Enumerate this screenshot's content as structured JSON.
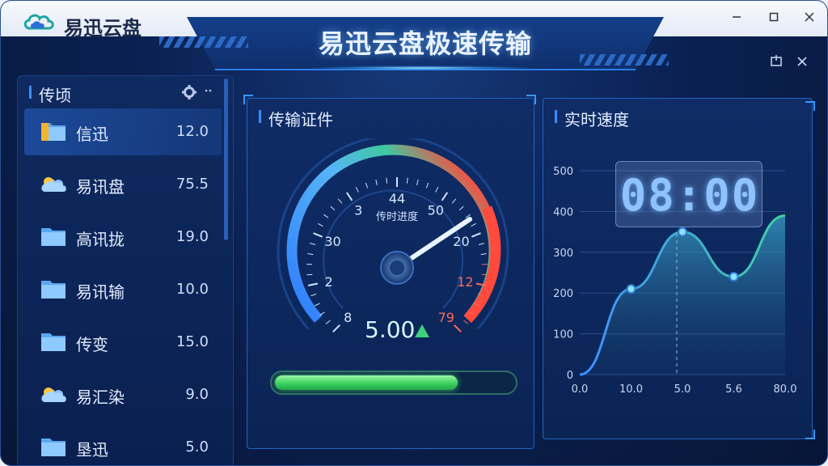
{
  "app": {
    "name": "易迅云盘",
    "title": "易迅云盘极速传输"
  },
  "colors": {
    "accent": "#3a8dff",
    "progress": "#3bd160",
    "gauge_low": "#2e7bff",
    "gauge_high": "#ff4a3d",
    "chart_line": "#3fa9ff"
  },
  "sidebar": {
    "title": "传顷",
    "items": [
      {
        "name": "信迅",
        "value": "12.0",
        "icon": "folder-icon",
        "selected": true
      },
      {
        "name": "易讯盘",
        "value": "75.5",
        "icon": "cloud-icon"
      },
      {
        "name": "高讯拢",
        "value": "19.0",
        "icon": "folder-icon"
      },
      {
        "name": "易讯输",
        "value": "10.0",
        "icon": "folder-icon"
      },
      {
        "name": "传变",
        "value": "15.0",
        "icon": "folder-icon"
      },
      {
        "name": "易汇染",
        "value": "9.0",
        "icon": "cloud-icon"
      },
      {
        "name": "垦迅",
        "value": "5.0",
        "icon": "folder-icon"
      }
    ]
  },
  "transfer_panel": {
    "title": "传输证件",
    "gauge_caption": "传时进度",
    "ticks": [
      "8",
      "2",
      "30",
      "3",
      "44",
      "50",
      "20",
      "12",
      "79"
    ],
    "value": "5.00",
    "progress": 0.76
  },
  "speed_panel": {
    "title": "实时速度",
    "clock": "08:00"
  },
  "chart_data": {
    "type": "line",
    "x_ticks": [
      "0.0",
      "10.0",
      "5.0",
      "5.6",
      "80.0"
    ],
    "y_ticks": [
      "0",
      "100",
      "200",
      "300",
      "400",
      "500"
    ],
    "ylim": [
      0,
      500
    ],
    "series": [
      {
        "values": [
          0,
          210,
          350,
          240,
          390
        ],
        "markers": [
          false,
          true,
          true,
          true,
          false
        ]
      }
    ]
  }
}
